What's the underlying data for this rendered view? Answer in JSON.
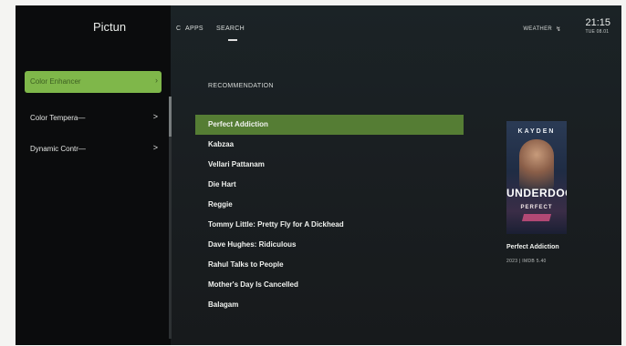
{
  "side_panel": {
    "title": "Pictun",
    "items": [
      {
        "label": "Color Enhancer",
        "arrow": "›",
        "active": true
      },
      {
        "label": "Color Tempera—",
        "arrow": ">",
        "active": false
      },
      {
        "label": "Dynamic Contr—",
        "arrow": ">",
        "active": false
      }
    ]
  },
  "nav": {
    "items": [
      "C",
      "APPS",
      "SEARCH"
    ],
    "active": "SEARCH",
    "weather_label": "WEATHER",
    "weather_icon": "rain-icon",
    "time": "21:15",
    "date": "TUE 08.01"
  },
  "recommendation": {
    "label": "RECOMMENDATION",
    "items": [
      "Perfect Addiction",
      "Kabzaa",
      "Vellari Pattanam",
      "Die Hart",
      "Reggie",
      "Tommy Little: Pretty Fly for A Dickhead",
      "Dave Hughes: Ridiculous",
      "Rahul Talks to People",
      "Mother's Day Is Cancelled",
      "Balagam"
    ],
    "selected_index": 0
  },
  "poster": {
    "top_text": "KAYDEN",
    "big_title": "UNDERDOG",
    "sub_title": "PERFECT",
    "caption": "Perfect Addiction",
    "meta": "2023 | IMDB 5.40"
  },
  "colors": {
    "accent_side": "#7fb74a",
    "accent_list": "#557d34"
  }
}
